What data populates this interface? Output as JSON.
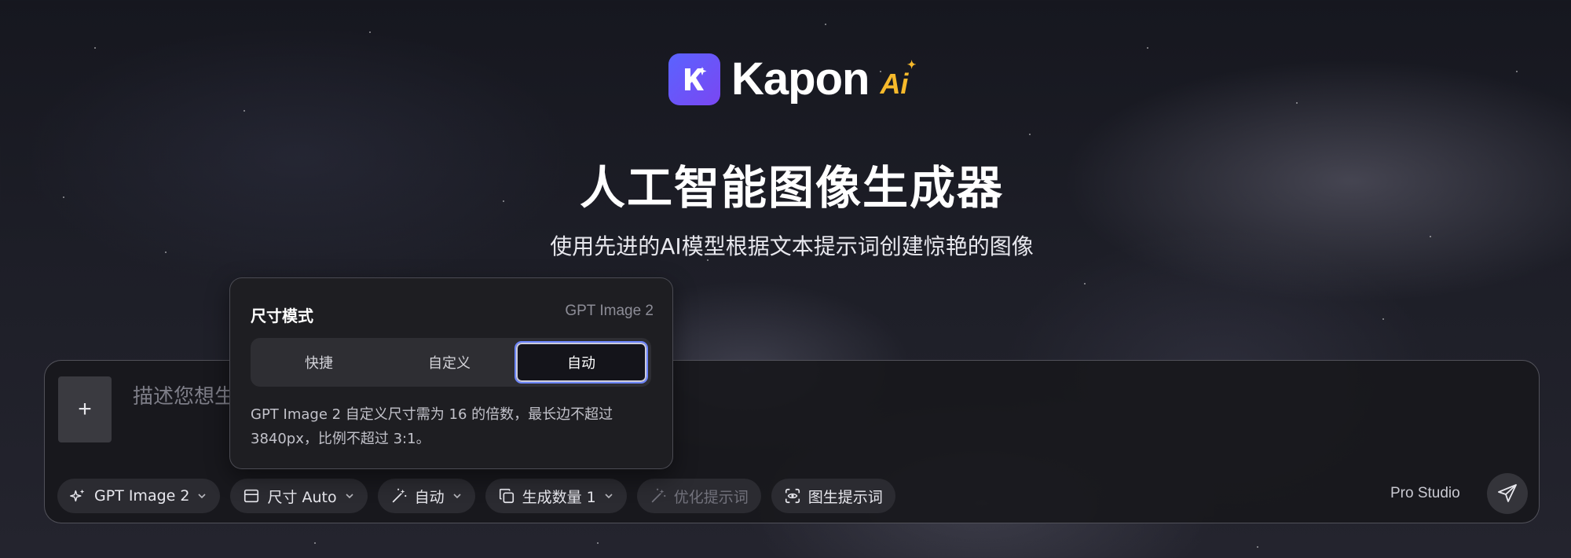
{
  "brand": {
    "badge_letter": "K",
    "name": "Kapon",
    "ai_mark": "Ai",
    "badge_color": "#5a63ff",
    "ai_color": "#f6b92b"
  },
  "hero": {
    "title": "人工智能图像生成器",
    "subtitle": "使用先进的AI模型根据文本提示词创建惊艳的图像"
  },
  "size_popover": {
    "title": "尺寸模式",
    "model": "GPT Image 2",
    "modes": [
      "快捷",
      "自定义",
      "自动"
    ],
    "selected_mode": "自动",
    "note": "GPT Image 2 自定义尺寸需为 16 的倍数，最长边不超过 3840px，比例不超过 3:1。"
  },
  "prompt": {
    "add_icon": "plus-icon",
    "placeholder": "描述您想生"
  },
  "toolbar": {
    "model_label": "GPT Image 2",
    "size_label": "尺寸 Auto",
    "style_label": "自动",
    "count_label": "生成数量 1",
    "optimize_label": "优化提示词",
    "image_prompt_label": "图生提示词",
    "pro_studio_label": "Pro Studio",
    "icons": {
      "model": "sparkle-icon",
      "size": "aspect-ratio-icon",
      "style": "magic-wand-icon",
      "count": "copy-icon",
      "optimize": "magic-wand-icon",
      "image_prompt": "scan-eye-icon",
      "send": "send-icon"
    }
  },
  "accent_colors": {
    "active_segment_border": "#6d86ff",
    "card_background": "#18181c"
  }
}
